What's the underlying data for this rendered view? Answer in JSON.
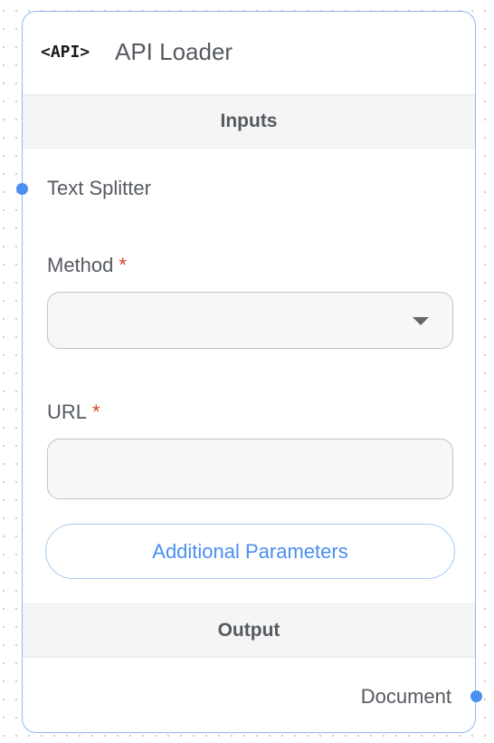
{
  "node": {
    "logo_text": "<API>",
    "title": "API Loader"
  },
  "sections": {
    "inputs_label": "Inputs",
    "output_label": "Output"
  },
  "inputs": {
    "anchor_label": "Text Splitter",
    "method": {
      "label": "Method",
      "required_mark": "*",
      "selected_value": ""
    },
    "url": {
      "label": "URL",
      "required_mark": "*",
      "value": "",
      "placeholder": ""
    },
    "additional_params_label": "Additional Parameters"
  },
  "output": {
    "anchor_label": "Document"
  },
  "colors": {
    "accent": "#4a8ff0",
    "node_border": "#8fb8f0",
    "required": "#e0412f",
    "section_bg": "#f5f5f5",
    "text": "#555a60"
  }
}
